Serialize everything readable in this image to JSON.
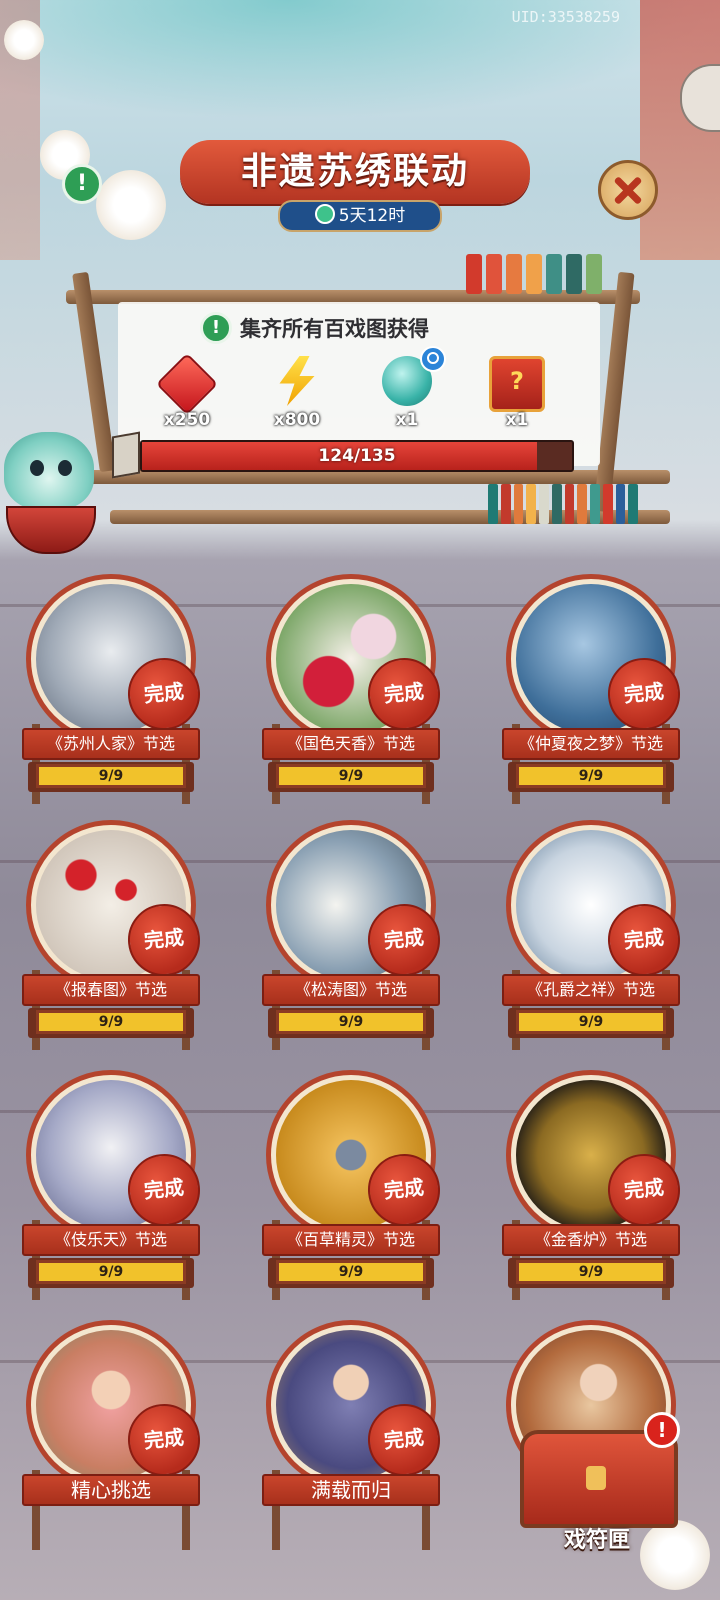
{
  "uid": "UID:33538259",
  "header": {
    "title": "非遗苏绣联动",
    "timer": "5天12时"
  },
  "icons": {
    "info": "exclamation-info-icon",
    "close": "close-x-icon",
    "timer": "clock-icon"
  },
  "rewards": {
    "collect_text": "集齐所有百戏图获得",
    "items": [
      {
        "icon": "red-gem-icon",
        "count": "x250"
      },
      {
        "icon": "lightning-bolt-icon",
        "count": "x800"
      },
      {
        "icon": "teal-gourd-icon",
        "count": "x1"
      },
      {
        "icon": "mystery-chest-icon",
        "count": "x1"
      }
    ],
    "progress": {
      "text": "124/135",
      "current": 124,
      "total": 135
    }
  },
  "cards": [
    {
      "title": "《苏州人家》节选",
      "status": "完成",
      "count": "9/9"
    },
    {
      "title": "《国色天香》节选",
      "status": "完成",
      "count": "9/9"
    },
    {
      "title": "《仲夏夜之梦》节选",
      "status": "完成",
      "count": "9/9"
    },
    {
      "title": "《报春图》节选",
      "status": "完成",
      "count": "9/9"
    },
    {
      "title": "《松涛图》节选",
      "status": "完成",
      "count": "9/9"
    },
    {
      "title": "《孔爵之祥》节选",
      "status": "完成",
      "count": "9/9"
    },
    {
      "title": "《伎乐天》节选",
      "status": "完成",
      "count": "9/9"
    },
    {
      "title": "《百草精灵》节选",
      "status": "完成",
      "count": "9/9"
    },
    {
      "title": "《金香炉》节选",
      "status": "完成",
      "count": "9/9"
    },
    {
      "title": "精心挑选",
      "status": "完成"
    },
    {
      "title": "满载而归",
      "status": "完成"
    },
    {
      "title": "",
      "status": ""
    }
  ],
  "chest_button": {
    "label": "戏符匣",
    "badge": "!"
  },
  "colors": {
    "accent_red": "#b8361f",
    "progress_bar": "#d0302a",
    "count_bar": "#f1c22b",
    "timer_bg": "#1f4f8a"
  }
}
